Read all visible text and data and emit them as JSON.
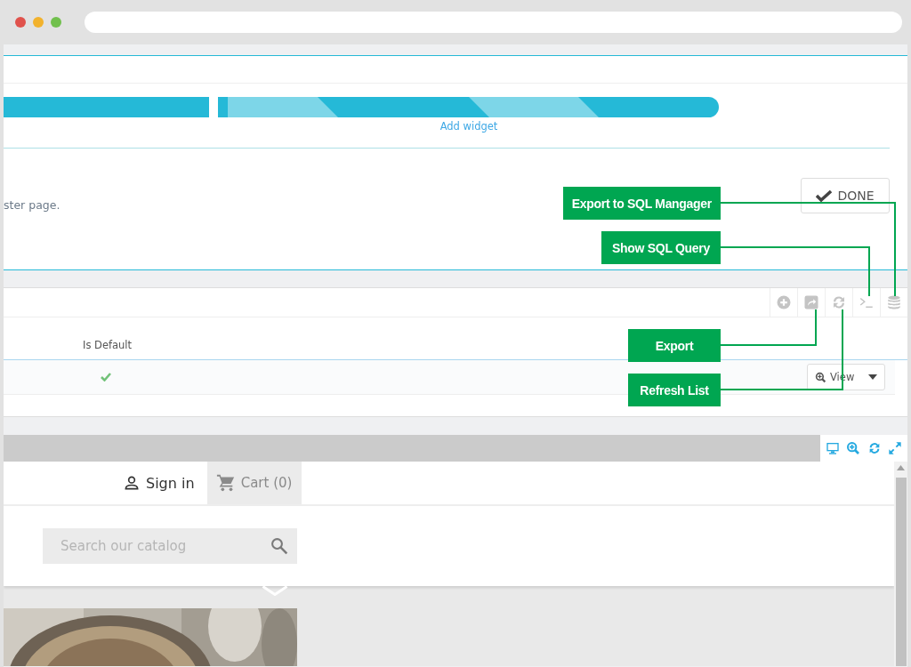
{
  "editor": {
    "add_widget": "Add widget",
    "description": "ster page.",
    "done_button": "DONE"
  },
  "list": {
    "toolbar": [
      {
        "kind": "add"
      },
      {
        "kind": "export"
      },
      {
        "kind": "refresh"
      },
      {
        "kind": "sql"
      },
      {
        "kind": "database"
      }
    ],
    "columns": [
      "Is Default"
    ],
    "rows": [
      {
        "is_default": true,
        "action": "View"
      }
    ]
  },
  "preview": {
    "toolbar": [
      {
        "kind": "desktop"
      },
      {
        "kind": "zoom"
      },
      {
        "kind": "refresh"
      },
      {
        "kind": "fullscreen"
      }
    ],
    "sign_in": "Sign in",
    "cart": "Cart (0)",
    "search_placeholder": "Search our catalog"
  },
  "callouts": [
    {
      "label": "Export to SQL Mangager"
    },
    {
      "label": "Show SQL Query"
    },
    {
      "label": "Export"
    },
    {
      "label": "Refresh List"
    }
  ]
}
